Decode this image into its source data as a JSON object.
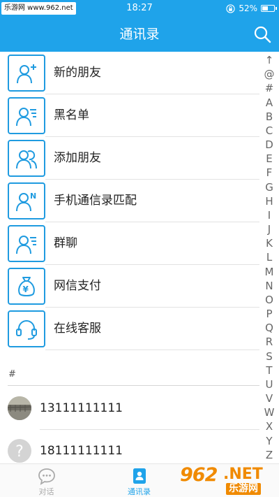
{
  "status_bar": {
    "watermark_text": "乐游网 www.962.net",
    "time": "18:27",
    "battery": "52%",
    "battery_level": 0.52
  },
  "header": {
    "title": "通讯录"
  },
  "menu": [
    {
      "label": "新的朋友",
      "icon": "add-person-icon"
    },
    {
      "label": "黑名单",
      "icon": "blacklist-icon"
    },
    {
      "label": "添加朋友",
      "icon": "group-icon"
    },
    {
      "label": "手机通信录匹配",
      "icon": "phone-contacts-icon"
    },
    {
      "label": "群聊",
      "icon": "group-chat-icon"
    },
    {
      "label": "网信支付",
      "icon": "money-bag-icon"
    },
    {
      "label": "在线客服",
      "icon": "headset-icon"
    }
  ],
  "section": {
    "header": "#"
  },
  "contacts": [
    {
      "name": "13111111111",
      "avatar": "photo-avatar"
    },
    {
      "name": "18111111111",
      "avatar": "question-avatar"
    }
  ],
  "alphabet": [
    "↑",
    "@",
    "#",
    "A",
    "B",
    "C",
    "D",
    "E",
    "F",
    "G",
    "H",
    "I",
    "J",
    "K",
    "L",
    "M",
    "N",
    "O",
    "P",
    "Q",
    "R",
    "S",
    "T",
    "U",
    "V",
    "W",
    "X",
    "Y",
    "Z"
  ],
  "bottom_nav": [
    {
      "label": "对话",
      "icon": "chat-bubble-icon",
      "active": false
    },
    {
      "label": "通讯录",
      "icon": "contacts-book-icon",
      "active": true
    }
  ],
  "watermark": {
    "logo": "962",
    "net": ".NET",
    "cn": "乐游网"
  },
  "colors": {
    "primary": "#1fa3ea",
    "icon_border": "#1f9be0",
    "watermark": "#f08a00",
    "inactive": "#aaaaaa"
  }
}
